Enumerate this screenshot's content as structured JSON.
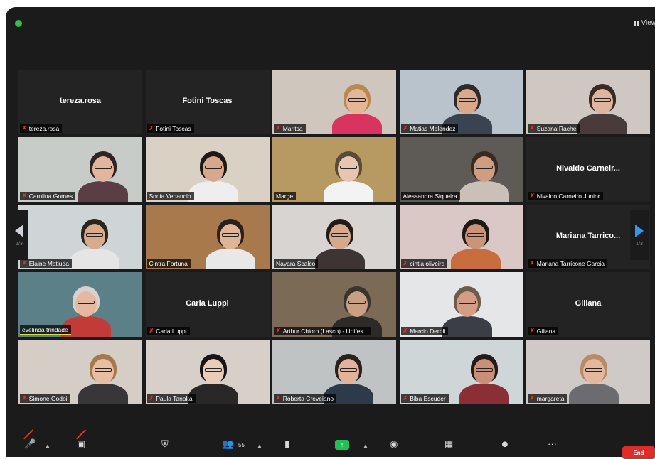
{
  "window": {
    "view_label": "View"
  },
  "participants": [
    {
      "name": "tereza.rosa",
      "video": false,
      "muted": true
    },
    {
      "name": "Fotini Toscas",
      "video": false,
      "muted": true
    },
    {
      "name": "Maritsa",
      "video": true,
      "muted": true,
      "bg": "#cfc7bd",
      "skin": "#e3b699",
      "shirt": "#d8345f",
      "hair": "#b88a4f"
    },
    {
      "name": "Matias Melendez",
      "video": true,
      "muted": true,
      "bg": "#b9c3cc",
      "skin": "#d9a98a",
      "shirt": "#3a4450",
      "hair": "#2e2a28"
    },
    {
      "name": "Suzana Rachel",
      "video": true,
      "muted": true,
      "bg": "#cfc8c2",
      "skin": "#e0b59d",
      "shirt": "#4a3b3b",
      "hair": "#3b2a22"
    },
    {
      "name": "Carolina Gomes",
      "video": true,
      "muted": true,
      "bg": "#c8ccc9",
      "skin": "#e2b59c",
      "shirt": "#5b3d46",
      "hair": "#2f241f"
    },
    {
      "name": "Sonia Venancio",
      "video": true,
      "muted": false,
      "bg": "#d9d2c4",
      "skin": "#d7a88c",
      "shirt": "#eeeeee",
      "hair": "#1f1916"
    },
    {
      "name": "Marge",
      "video": true,
      "muted": false,
      "bg": "#b79a61",
      "skin": "#e8c5af",
      "shirt": "#f3f3f3",
      "hair": "#5a4a3a"
    },
    {
      "name": "Alessandra Siqueira",
      "video": true,
      "muted": false,
      "active": true,
      "bg": "#5e5a56",
      "skin": "#cf9d80",
      "shirt": "#c9c1b8",
      "hair": "#3a2b22"
    },
    {
      "name": "Nivaldo  Carneir...",
      "label": "Nivaldo Carneiro Junior",
      "video": false,
      "muted": true
    },
    {
      "name": "Elaine Matiuda",
      "video": true,
      "muted": true,
      "bg": "#cfd5d6",
      "skin": "#d8ab8d",
      "shirt": "#e5e5e5",
      "hair": "#2a2520"
    },
    {
      "name": "Cintra Fortuna",
      "video": true,
      "muted": false,
      "bg": "#a87a4b",
      "skin": "#e0b597",
      "shirt": "#e8e8e8",
      "hair": "#2b211b"
    },
    {
      "name": "Nayara Scalco",
      "video": true,
      "muted": false,
      "bg": "#d8d4d2",
      "skin": "#d7a98c",
      "shirt": "#3d3533",
      "hair": "#221a16"
    },
    {
      "name": "cintia oliveira",
      "video": true,
      "muted": true,
      "bg": "#d9c8c5",
      "skin": "#c99478",
      "shirt": "#c76d3e",
      "hair": "#1e1714"
    },
    {
      "name": "Mariana  Tarrico...",
      "label": "Mariana Tarricone Garcia",
      "video": false,
      "muted": true
    },
    {
      "name": "evelinda trindade",
      "video": true,
      "muted": false,
      "speaking": true,
      "bg": "#5c8087",
      "skin": "#e5b9a0",
      "shirt": "#c23b36",
      "hair": "#d8d2cc"
    },
    {
      "name": "Carla Luppi",
      "video": false,
      "muted": true
    },
    {
      "name": "Arthur Chioro (Lasco) - Unifes...",
      "video": true,
      "muted": true,
      "bg": "#7a6a56",
      "skin": "#caa083",
      "shirt": "#2d2a2a",
      "hair": "#3a342f"
    },
    {
      "name": "Marcio Derbli",
      "video": true,
      "muted": true,
      "bg": "#e4e6e7",
      "skin": "#d39e83",
      "shirt": "#3b3e45",
      "hair": "#6e5b4c"
    },
    {
      "name": "Giliana",
      "video": false,
      "muted": true
    },
    {
      "name": "Simone Godoi",
      "video": true,
      "muted": true,
      "bg": "#d4cec6",
      "skin": "#e5bea4",
      "shirt": "#39363a",
      "hair": "#a6784e"
    },
    {
      "name": "Paula Tanaka",
      "video": true,
      "muted": true,
      "bg": "#d7d0c8",
      "skin": "#e9cdbb",
      "shirt": "#2a2728",
      "hair": "#1a1414"
    },
    {
      "name": "Roberta Creveiano",
      "video": true,
      "muted": true,
      "bg": "#bfc3c3",
      "skin": "#e0b39a",
      "shirt": "#2d3a4a",
      "hair": "#2b211b"
    },
    {
      "name": "Biba Escuder",
      "video": true,
      "muted": true,
      "bg": "#cfd6d8",
      "skin": "#c99079",
      "shirt": "#8a2f35",
      "hair": "#241a16"
    },
    {
      "name": "margareta",
      "video": true,
      "muted": true,
      "bg": "#cfcac7",
      "skin": "#e3b99e",
      "shirt": "#6b6b70",
      "hair": "#b78c63"
    }
  ],
  "pager": {
    "left_page": "1/3",
    "right_page": "1/3"
  },
  "toolbar": {
    "participants_count": "55",
    "end_label": "End"
  },
  "colors": {
    "active_speaker": "#d8df3a",
    "muted_icon": "#e8302c",
    "end_button": "#e02b27",
    "share_button": "#1ec153"
  }
}
